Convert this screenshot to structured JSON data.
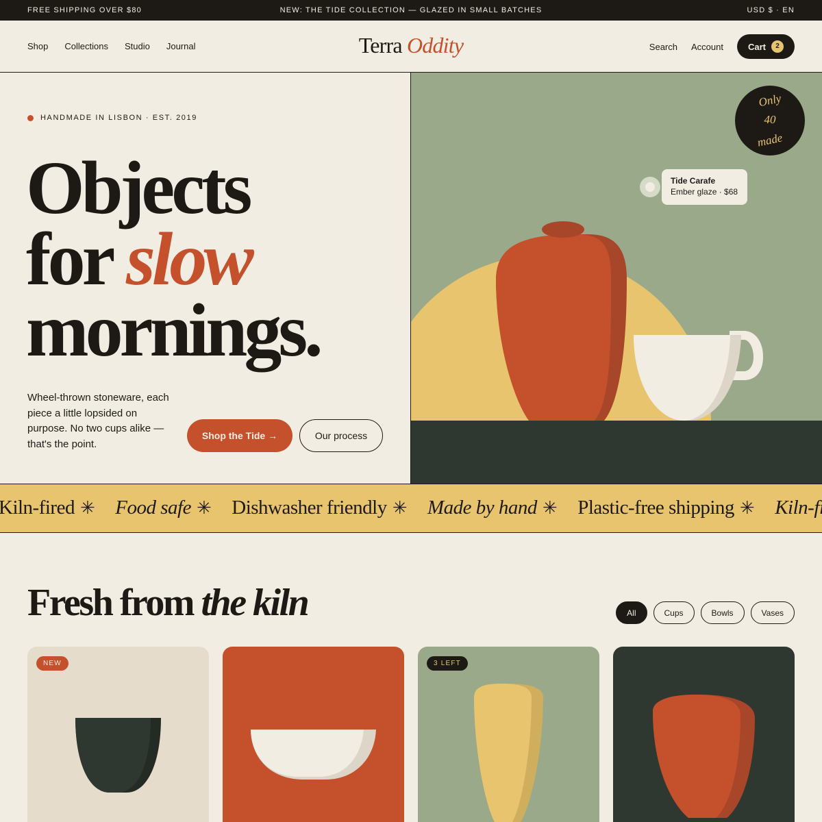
{
  "announcement": {
    "left": "FREE SHIPPING OVER $80",
    "center": "NEW: THE TIDE COLLECTION — GLAZED IN SMALL BATCHES",
    "right": "USD $ · EN"
  },
  "nav": {
    "items": [
      "Shop",
      "Collections",
      "Studio",
      "Journal"
    ]
  },
  "logo": {
    "primary": "Terra",
    "accent": "Oddity"
  },
  "header_right": {
    "search": "Search",
    "account": "Account",
    "cart_label": "Cart",
    "cart_count": "2"
  },
  "hero": {
    "eyebrow": "HANDMADE IN LISBON · EST. 2019",
    "headline_line1": "Objects",
    "headline_line2_plain": "for ",
    "headline_line2_accent": "slow",
    "headline_line3": "mornings.",
    "description": "Wheel-thrown stoneware, each piece a little lopsided on purpose. No two cups alike — that's the point.",
    "cta_primary": "Shop the Tide →",
    "cta_secondary": "Our process",
    "badge": {
      "line1": "Only",
      "line2": "40",
      "line3": "made"
    },
    "tooltip": {
      "title": "Tide Carafe",
      "subtitle": "Ember glaze · $68"
    }
  },
  "marquee": {
    "items": [
      {
        "text": "Kiln-fired",
        "italic": false
      },
      {
        "text": "Food safe",
        "italic": true
      },
      {
        "text": "Dishwasher friendly",
        "italic": false
      },
      {
        "text": "Made by hand",
        "italic": true
      },
      {
        "text": "Plastic-free shipping",
        "italic": false
      },
      {
        "text": "Kiln-fired",
        "italic": true
      }
    ],
    "separator": "✳"
  },
  "products_section": {
    "title_plain": "Fresh from ",
    "title_accent": "the kiln",
    "filters": [
      "All",
      "Cups",
      "Bowls",
      "Vases"
    ],
    "active_filter": "All",
    "cards": [
      {
        "badge": "NEW",
        "bg": "#e5dccb"
      },
      {
        "badge": "",
        "bg": "#c4502c"
      },
      {
        "badge": "3 LEFT",
        "bg": "#9aa98a"
      },
      {
        "badge": "",
        "bg": "#2f3830"
      }
    ]
  },
  "colors": {
    "cream": "#f2ede3",
    "ink": "#1d1a16",
    "terracotta": "#c4502c",
    "mustard": "#e8c46f",
    "sage": "#9aa98a",
    "forest": "#2f3830"
  }
}
